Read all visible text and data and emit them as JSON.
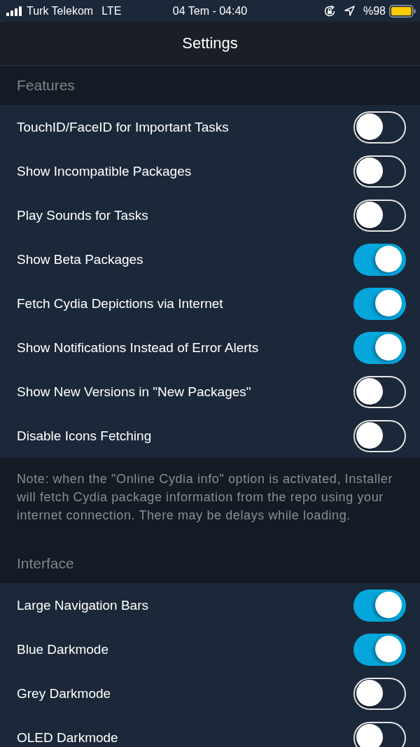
{
  "status_bar": {
    "carrier": "Turk Telekom",
    "network": "LTE",
    "datetime": "04 Tem - 04:40",
    "battery": "%98"
  },
  "navigation_bar": {
    "title": "Settings"
  },
  "sections": [
    {
      "header": "Features",
      "items": [
        {
          "label": "TouchID/FaceID for Important Tasks",
          "on": false
        },
        {
          "label": "Show Incompatible Packages",
          "on": false
        },
        {
          "label": "Play Sounds for Tasks",
          "on": false
        },
        {
          "label": "Show Beta Packages",
          "on": true
        },
        {
          "label": "Fetch Cydia Depictions via Internet",
          "on": true
        },
        {
          "label": "Show Notifications Instead of Error Alerts",
          "on": true
        },
        {
          "label": "Show New Versions in \"New Packages\"",
          "on": false
        },
        {
          "label": "Disable Icons Fetching",
          "on": false
        }
      ],
      "footer": "Note: when the \"Online Cydia info\" option is activated, Installer will fetch Cydia package information from the repo using your internet connection. There may be delays while loading."
    },
    {
      "header": "Interface",
      "items": [
        {
          "label": "Large Navigation Bars",
          "on": true
        },
        {
          "label": "Blue Darkmode",
          "on": true
        },
        {
          "label": "Grey Darkmode",
          "on": false
        },
        {
          "label": "OLED Darkmode",
          "on": false
        }
      ]
    }
  ]
}
